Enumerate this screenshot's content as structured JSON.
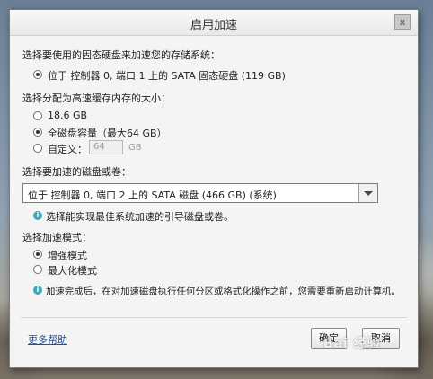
{
  "window": {
    "title": "启用加速",
    "close_glyph": "x"
  },
  "storage": {
    "label": "选择要使用的固态硬盘来加速您的存储系统：",
    "option": "位于 控制器 0, 端口 1 上的 SATA 固态硬盘 (119 GB)"
  },
  "cache_size": {
    "label": "选择分配为高速缓存内存的大小：",
    "options": [
      "18.6 GB",
      "全磁盘容量（最大64 GB）",
      "自定义："
    ],
    "selected_index": 1,
    "custom_value": "64",
    "custom_unit": "GB"
  },
  "target_disk": {
    "label": "选择要加速的磁盘或卷：",
    "selected": "位于 控制器 0, 端口 2 上的 SATA 磁盘 (466 GB) (系统)",
    "hint": "选择能实现最佳系统加速的引导磁盘或卷。"
  },
  "mode": {
    "label": "选择加速模式：",
    "options": [
      "增强模式",
      "最大化模式"
    ],
    "selected_index": 0
  },
  "notice": "加速完成后，在对加速磁盘执行任何分区或格式化操作之前，您需要重新启动计算机。",
  "footer": {
    "help_link": "更多帮助",
    "ok_label": "确定",
    "cancel_label": "取消"
  },
  "watermark": "Bai 经验",
  "colors": {
    "info_icon": "#3fa7b8",
    "link": "#1f4f9a"
  }
}
